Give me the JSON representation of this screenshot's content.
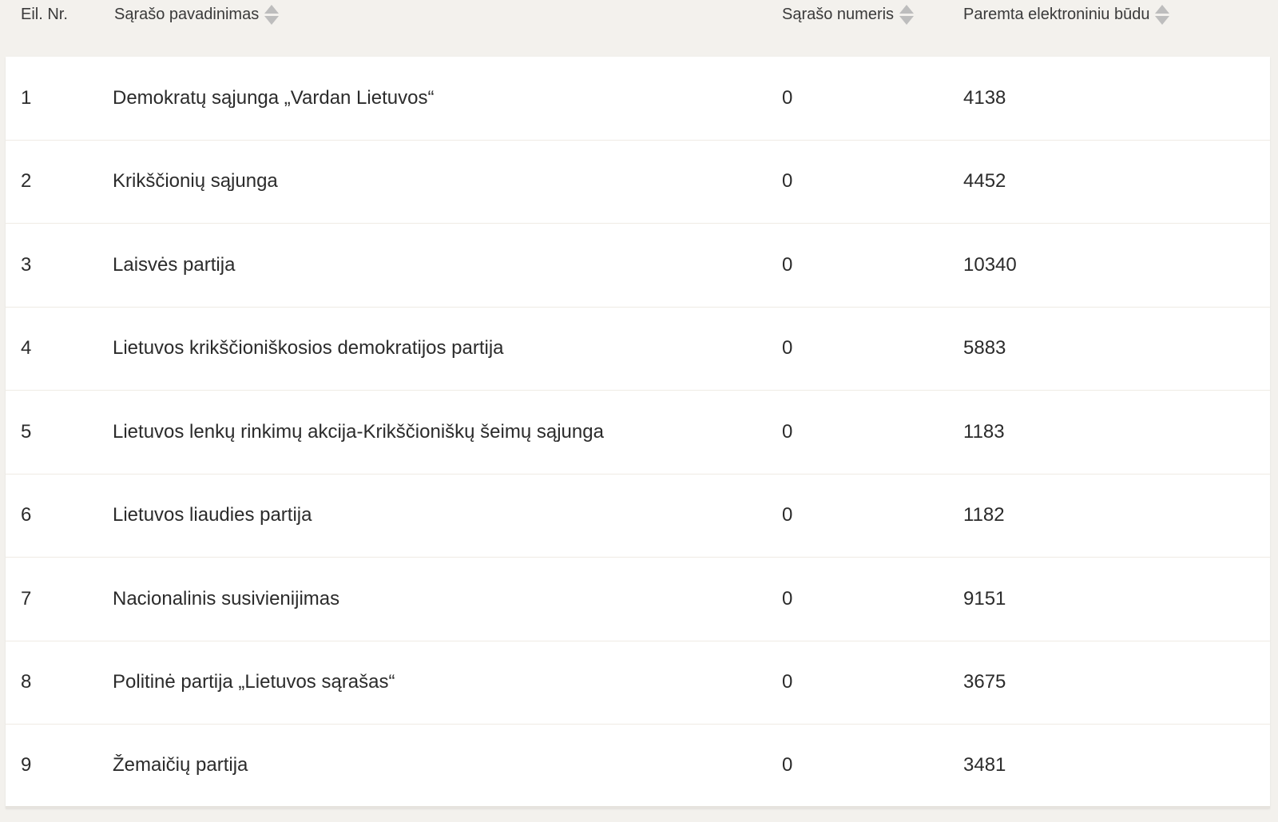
{
  "table": {
    "headers": {
      "nr": "Eil. Nr.",
      "name": "Sąrašo pavadinimas",
      "number": "Sąrašo numeris",
      "electronic": "Paremta elektroniniu būdu"
    },
    "rows": [
      {
        "nr": "1",
        "name": "Demokratų sąjunga „Vardan Lietuvos“",
        "number": "0",
        "electronic": "4138"
      },
      {
        "nr": "2",
        "name": "Krikščionių sąjunga",
        "number": "0",
        "electronic": "4452"
      },
      {
        "nr": "3",
        "name": "Laisvės partija",
        "number": "0",
        "electronic": "10340"
      },
      {
        "nr": "4",
        "name": "Lietuvos krikščioniškosios demokratijos partija",
        "number": "0",
        "electronic": "5883"
      },
      {
        "nr": "5",
        "name": "Lietuvos lenkų rinkimų akcija-Krikščioniškų šeimų sąjunga",
        "number": "0",
        "electronic": "1183"
      },
      {
        "nr": "6",
        "name": "Lietuvos liaudies partija",
        "number": "0",
        "electronic": "1182"
      },
      {
        "nr": "7",
        "name": "Nacionalinis susivienijimas",
        "number": "0",
        "electronic": "9151"
      },
      {
        "nr": "8",
        "name": "Politinė partija „Lietuvos sąrašas“",
        "number": "0",
        "electronic": "3675"
      },
      {
        "nr": "9",
        "name": "Žemaičių partija",
        "number": "0",
        "electronic": "3481"
      }
    ]
  },
  "icons": {
    "sort": "sort-icon"
  },
  "colors": {
    "background": "#f3f1ed",
    "row_background": "#ffffff",
    "sort_icon": "#bdbdbd",
    "text": "#2b2b2b"
  }
}
